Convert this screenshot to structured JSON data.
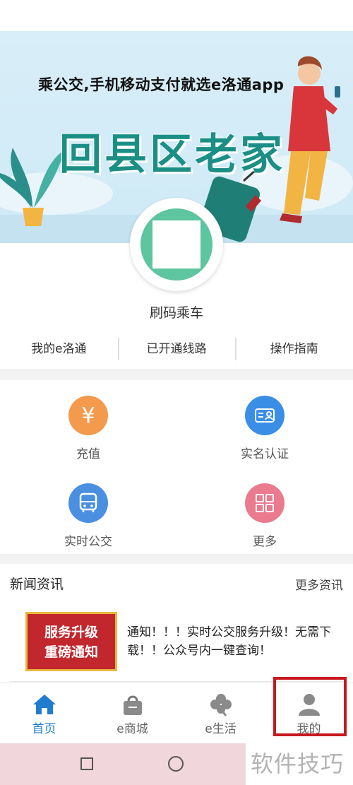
{
  "banner": {
    "title": "乘公交,手机移动支付就选e洛通app",
    "big_text": "回县区老家"
  },
  "scan": {
    "label": "刷码乘车"
  },
  "quick_links": [
    {
      "label": "我的e洛通"
    },
    {
      "label": "已开通线路"
    },
    {
      "label": "操作指南"
    }
  ],
  "grid": [
    {
      "label": "充值",
      "icon": "yen-icon",
      "color": "#f39a4c"
    },
    {
      "label": "实名认证",
      "icon": "id-card-icon",
      "color": "#3a8ee6"
    },
    {
      "label": "实时公交",
      "icon": "bus-icon",
      "color": "#4a8fe0"
    },
    {
      "label": "更多",
      "icon": "grid-icon",
      "color": "#ea7a8e"
    }
  ],
  "news": {
    "title": "新闻资讯",
    "more": "更多资讯",
    "items": [
      {
        "thumb_line1": "服务升级",
        "thumb_line2": "重磅通知",
        "text": "通知！！！实时公交服务升级！无需下载！！公众号内一键查询！"
      }
    ]
  },
  "tabs": [
    {
      "label": "首页",
      "icon": "home-icon",
      "active": true
    },
    {
      "label": "e商城",
      "icon": "shopping-bag-icon",
      "active": false
    },
    {
      "label": "e生活",
      "icon": "clover-icon",
      "active": false
    },
    {
      "label": "我的",
      "icon": "user-icon",
      "active": false
    }
  ],
  "watermark": "软件技巧",
  "colors": {
    "accent": "#1f7ccf",
    "highlight": "#c8191e",
    "qr_ring": "#5dc5a0"
  }
}
